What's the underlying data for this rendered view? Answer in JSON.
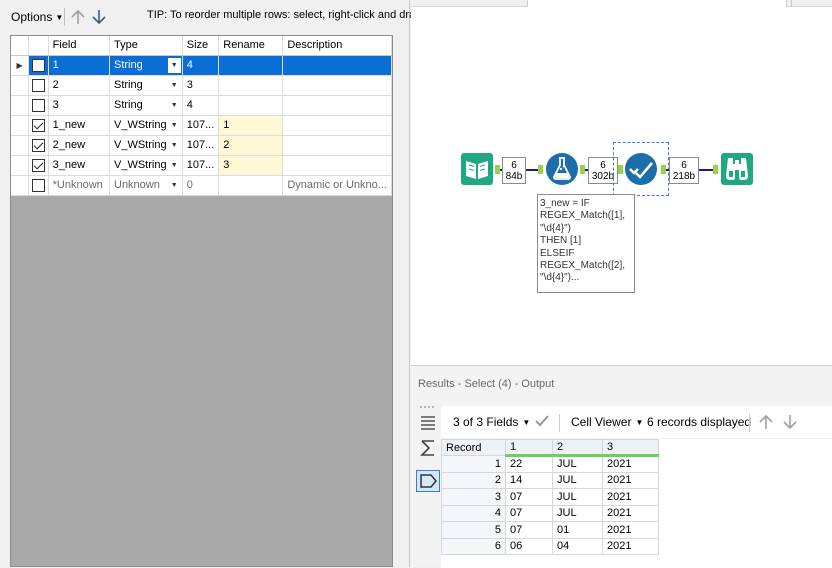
{
  "toolbar": {
    "options_label": "Options",
    "tip": "TIP: To reorder multiple rows: select, right-click and drag."
  },
  "field_table": {
    "headers": [
      "Field",
      "Type",
      "Size",
      "Rename",
      "Description"
    ],
    "rows": [
      {
        "checked": false,
        "field": "1",
        "type": "String",
        "size": "4",
        "rename": "",
        "description": "",
        "selected": true
      },
      {
        "checked": false,
        "field": "2",
        "type": "String",
        "size": "3",
        "rename": "",
        "description": "",
        "selected": false
      },
      {
        "checked": false,
        "field": "3",
        "type": "String",
        "size": "4",
        "rename": "",
        "description": "",
        "selected": false
      },
      {
        "checked": true,
        "field": "1_new",
        "type": "V_WString",
        "size": "107...",
        "rename": "1",
        "description": "",
        "selected": false
      },
      {
        "checked": true,
        "field": "2_new",
        "type": "V_WString",
        "size": "107...",
        "rename": "2",
        "description": "",
        "selected": false
      },
      {
        "checked": true,
        "field": "3_new",
        "type": "V_WString",
        "size": "107...",
        "rename": "3",
        "description": "",
        "selected": false
      },
      {
        "checked": false,
        "field": "*Unknown",
        "type": "Unknown",
        "size": "0",
        "rename": "",
        "description": "Dynamic or Unkno...",
        "selected": false
      }
    ]
  },
  "workflow": {
    "badges": [
      {
        "count": "6",
        "size": "84b"
      },
      {
        "count": "6",
        "size": "302b"
      },
      {
        "count": "6",
        "size": "218b"
      }
    ],
    "tooltip": "3_new = IF\nREGEX_Match([1],\n\"\\d{4}\")\nTHEN [1]\nELSEIF\nREGEX_Match([2],\n\"\\d{4}\")...",
    "colors": {
      "input": "#1fa882",
      "formula": "#1b6ea8",
      "select": "#1b6ea8",
      "browse": "#1fa882",
      "anchor": "#9bd14a",
      "connector": "#1a1a9a"
    }
  },
  "results": {
    "title": "Results - Select (4) - Output",
    "fields_label": "3 of 3 Fields",
    "viewer_label": "Cell Viewer",
    "records_label": "6 records displayed",
    "headers": [
      "Record",
      "1",
      "2",
      "3"
    ],
    "rows": [
      [
        "1",
        "22",
        "JUL",
        "2021"
      ],
      [
        "2",
        "14",
        "JUL",
        "2021"
      ],
      [
        "3",
        "07",
        "JUL",
        "2021"
      ],
      [
        "4",
        "07",
        "JUL",
        "2021"
      ],
      [
        "5",
        "07",
        "01",
        "2021"
      ],
      [
        "6",
        "06",
        "04",
        "2021"
      ]
    ]
  }
}
